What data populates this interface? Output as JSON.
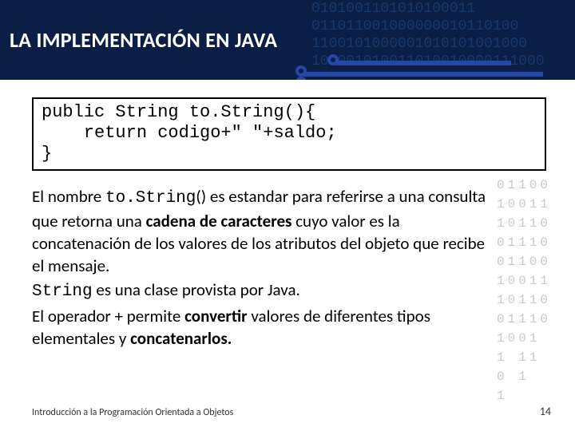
{
  "header": {
    "title": "LA IMPLEMENTACIÓN EN JAVA",
    "binary": "0101001101010100011\n011011001000000010110100\n1100101000001010101001000\n100001010011010010000111000"
  },
  "code": "public String to.String(){\n    return codigo+\" \"+saldo;\n}",
  "para": {
    "p1a": "El nombre ",
    "p1b": "to.String",
    "p1c": "() es estandar para referirse a una consulta que retorna una ",
    "p1d": "cadena de caracteres",
    "p1e": " cuyo valor es la concatenación de los valores de los atributos del objeto que recibe el mensaje.",
    "p2a": "String",
    "p2b": " es una clase provista por Java.",
    "p3a": "El operador + permite ",
    "p3b": "convertir",
    "p3c": " valores de diferentes tipos elementales y ",
    "p3d": "concatenarlos.",
    "p3e": ""
  },
  "side_binary": "01100\n10011\n10110\n01110\n01100\n10011\n10110\n01110\n1001\n1 11\n0 1\n1",
  "footer": {
    "left": "Introducción a la Programación Orientada a Objetos",
    "page": "14"
  }
}
